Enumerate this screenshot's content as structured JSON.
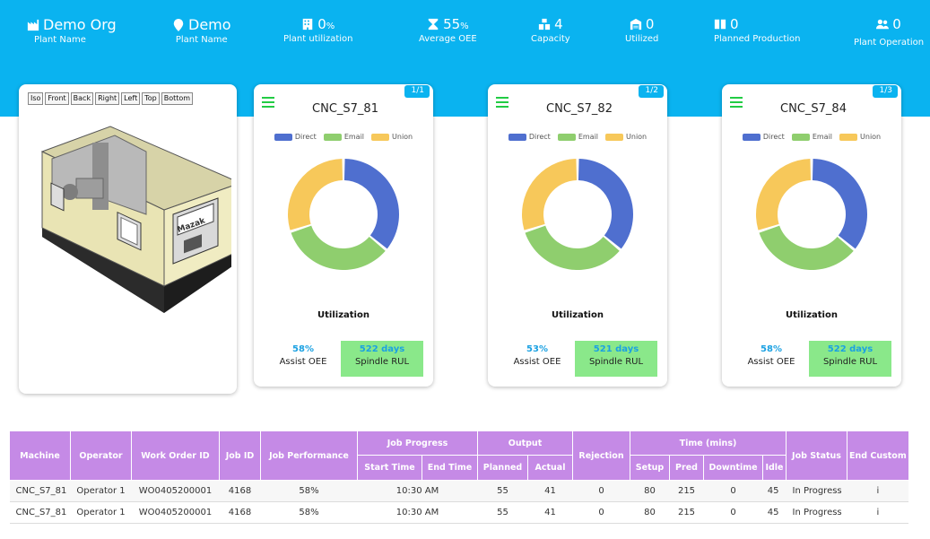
{
  "header": {
    "stats": [
      {
        "id": "org",
        "value": "Demo Org",
        "label": "Plant Name",
        "icon": "factory-icon"
      },
      {
        "id": "plant",
        "value": "Demo",
        "label": "Plant Name",
        "icon": "location-pin-icon"
      },
      {
        "id": "util",
        "value": "0",
        "unit": "%",
        "label": "Plant utilization",
        "icon": "building-icon"
      },
      {
        "id": "oee",
        "value": "55",
        "unit": "%",
        "label": "Average OEE",
        "icon": "hourglass-icon"
      },
      {
        "id": "cap",
        "value": "4",
        "label": "Capacity",
        "icon": "boxes-icon"
      },
      {
        "id": "utilized",
        "value": "0",
        "label": "Utilized",
        "icon": "warehouse-icon"
      },
      {
        "id": "planned",
        "value": "0",
        "label": "Planned Production",
        "icon": "book-icon"
      },
      {
        "id": "operation",
        "value": "0",
        "label": "Plant Operation",
        "icon": "users-icon"
      }
    ]
  },
  "viewer": {
    "buttons": [
      "Iso",
      "Front",
      "Back",
      "Right",
      "Left",
      "Top",
      "Bottom"
    ],
    "brand": "Mazak"
  },
  "legend": [
    {
      "label": "Direct",
      "color": "#4f6fcf"
    },
    {
      "label": "Email",
      "color": "#8fce6e"
    },
    {
      "label": "Union",
      "color": "#f7c85a"
    }
  ],
  "machines": [
    {
      "name": "CNC_S7_81",
      "page": "1/1",
      "chart_title": "Utilization",
      "oee": "58%",
      "oee_label": "Assist OEE",
      "rul": "522 days",
      "rul_label": "Spindle RUL"
    },
    {
      "name": "CNC_S7_82",
      "page": "1/2",
      "chart_title": "Utilization",
      "oee": "53%",
      "oee_label": "Assist OEE",
      "rul": "521 days",
      "rul_label": "Spindle RUL"
    },
    {
      "name": "CNC_S7_84",
      "page": "1/3",
      "chart_title": "Utilization",
      "oee": "58%",
      "oee_label": "Assist OEE",
      "rul": "522 days",
      "rul_label": "Spindle RUL"
    }
  ],
  "chart_data": [
    {
      "type": "pie",
      "title": "Utilization",
      "machine": "CNC_S7_81",
      "labels": [
        "Direct",
        "Email",
        "Union"
      ],
      "values": [
        36,
        34,
        30
      ],
      "colors": [
        "#4f6fcf",
        "#8fce6e",
        "#f7c85a"
      ]
    },
    {
      "type": "pie",
      "title": "Utilization",
      "machine": "CNC_S7_82",
      "labels": [
        "Direct",
        "Email",
        "Union"
      ],
      "values": [
        36,
        34,
        30
      ],
      "colors": [
        "#4f6fcf",
        "#8fce6e",
        "#f7c85a"
      ]
    },
    {
      "type": "pie",
      "title": "Utilization",
      "machine": "CNC_S7_84",
      "labels": [
        "Direct",
        "Email",
        "Union"
      ],
      "values": [
        36,
        34,
        30
      ],
      "colors": [
        "#4f6fcf",
        "#8fce6e",
        "#f7c85a"
      ]
    }
  ],
  "table": {
    "headers": {
      "machine": "Machine",
      "operator": "Operator",
      "work_order": "Work Order ID",
      "job_id": "Job ID",
      "job_perf": "Job Performance",
      "job_progress": "Job Progress",
      "start_time": "Start Time",
      "end_time": "End Time",
      "output": "Output",
      "planned": "Planned",
      "actual": "Actual",
      "rejection": "Rejection",
      "time": "Time (mins)",
      "setup": "Setup",
      "pred": "Pred",
      "downtime": "Downtime",
      "idle": "Idle",
      "job_status": "Job Status",
      "end_customer": "End Custom"
    },
    "rows": [
      {
        "machine": "CNC_S7_81",
        "operator": "Operator 1",
        "work_order": "WO0405200001",
        "job_id": "4168",
        "job_perf": "58%",
        "start_time": "10:30 AM",
        "end_time": "",
        "planned": "55",
        "actual": "41",
        "rejection": "0",
        "setup": "80",
        "pred": "215",
        "downtime": "0",
        "idle": "45",
        "job_status": "In Progress",
        "end_customer": "i"
      },
      {
        "machine": "CNC_S7_81",
        "operator": "Operator 1",
        "work_order": "WO0405200001",
        "job_id": "4168",
        "job_perf": "58%",
        "start_time": "10:30 AM",
        "end_time": "",
        "planned": "55",
        "actual": "41",
        "rejection": "0",
        "setup": "80",
        "pred": "215",
        "downtime": "0",
        "idle": "45",
        "job_status": "In Progress",
        "end_customer": "i"
      }
    ]
  }
}
